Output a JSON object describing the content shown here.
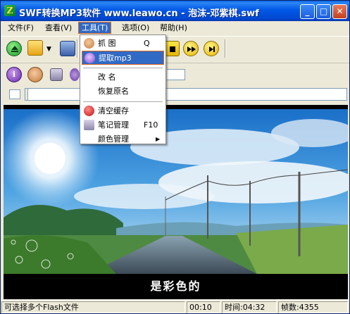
{
  "window": {
    "title": "SWF转换MP3软件 www.leawo.cn - 泡沫-邓紫棋.swf",
    "app_icon_glyph": "Z",
    "minimize_glyph": "_",
    "maximize_glyph": "□",
    "close_glyph": "✕"
  },
  "menubar": {
    "items": [
      "文件(F)",
      "查看(V)",
      "工具(T)",
      "选项(O)",
      "帮助(H)"
    ]
  },
  "tools_menu": {
    "items": [
      {
        "label": "抓    图",
        "shortcut": "Q",
        "icon": "snapshot-icon"
      },
      {
        "label": "提取mp3",
        "shortcut": "",
        "icon": "extract-mp3-icon",
        "selected": true
      },
      {
        "label": "改    名",
        "shortcut": "",
        "icon": ""
      },
      {
        "label": "恢复原名",
        "shortcut": "",
        "icon": ""
      },
      {
        "label": "清空缓存",
        "shortcut": "",
        "icon": "clear-cache-icon"
      },
      {
        "label": "笔记管理",
        "shortcut": "F10",
        "icon": "notes-icon"
      },
      {
        "label": "颜色管理",
        "shortcut": "▶",
        "icon": ""
      }
    ]
  },
  "video": {
    "subtitle": "是彩色的"
  },
  "statusbar": {
    "hint": "可选择多个Flash文件",
    "position": "00:10",
    "duration": "时间:04:32",
    "frames": "帧数:4355"
  },
  "colors": {
    "titlebar": "#0058e6",
    "menu_highlight": "#316ac5",
    "menu_highlight_border": "#e06a1a"
  }
}
